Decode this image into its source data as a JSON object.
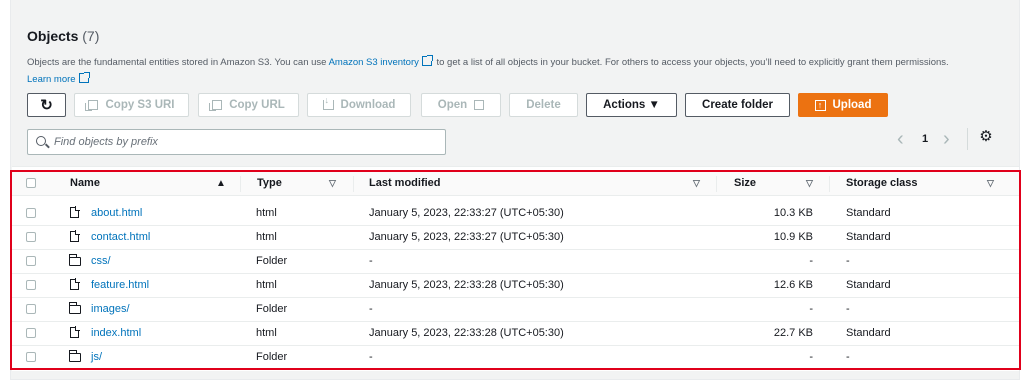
{
  "header": {
    "title": "Objects",
    "count": "(7)",
    "desc_pre": "Objects are the fundamental entities stored in Amazon S3. You can use ",
    "desc_link": "Amazon S3 inventory",
    "desc_post": " to get a list of all objects in your bucket. For others to access your objects, you’ll need to explicitly grant them permissions.",
    "learn_more": "Learn more"
  },
  "toolbar": {
    "copy_uri": "Copy S3 URI",
    "copy_url": "Copy URL",
    "download": "Download",
    "open": "Open",
    "delete": "Delete",
    "actions": "Actions ▼",
    "create_folder": "Create folder",
    "upload": "Upload"
  },
  "search": {
    "placeholder": "Find objects by prefix"
  },
  "pagination": {
    "page": "1",
    "prev": "‹",
    "next": "›"
  },
  "table": {
    "columns": {
      "name": "Name",
      "type": "Type",
      "modified": "Last modified",
      "size": "Size",
      "storage": "Storage class"
    },
    "rows": [
      {
        "icon": "file-icon",
        "name": "about.html",
        "type": "html",
        "modified": "January 5, 2023, 22:33:27 (UTC+05:30)",
        "size": "10.3 KB",
        "storage": "Standard"
      },
      {
        "icon": "file-icon",
        "name": "contact.html",
        "type": "html",
        "modified": "January 5, 2023, 22:33:27 (UTC+05:30)",
        "size": "10.9 KB",
        "storage": "Standard"
      },
      {
        "icon": "folder-icon",
        "name": "css/",
        "type": "Folder",
        "modified": "-",
        "size": "-",
        "storage": "-"
      },
      {
        "icon": "file-icon",
        "name": "feature.html",
        "type": "html",
        "modified": "January 5, 2023, 22:33:28 (UTC+05:30)",
        "size": "12.6 KB",
        "storage": "Standard"
      },
      {
        "icon": "folder-icon",
        "name": "images/",
        "type": "Folder",
        "modified": "-",
        "size": "-",
        "storage": "-"
      },
      {
        "icon": "file-icon",
        "name": "index.html",
        "type": "html",
        "modified": "January 5, 2023, 22:33:28 (UTC+05:30)",
        "size": "22.7 KB",
        "storage": "Standard"
      },
      {
        "icon": "folder-icon",
        "name": "js/",
        "type": "Folder",
        "modified": "-",
        "size": "-",
        "storage": "-"
      }
    ]
  },
  "colors": {
    "accent": "#ec7211",
    "link": "#0073bb",
    "highlight": "#e0001b"
  }
}
